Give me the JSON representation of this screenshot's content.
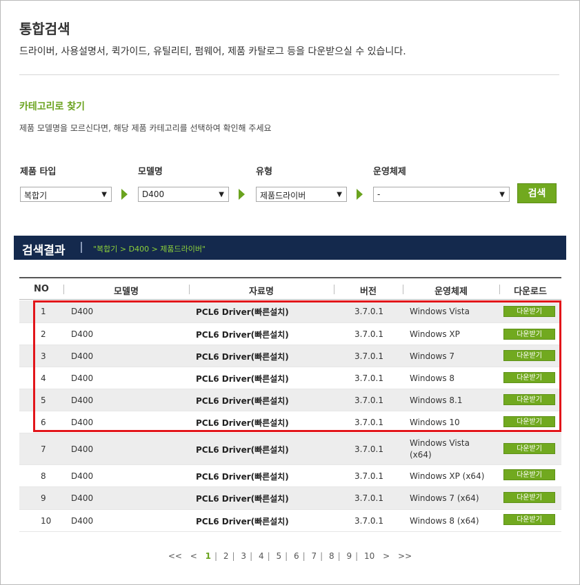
{
  "page": {
    "title": "통합검색",
    "description": "드라이버, 사용설명서, 퀵가이드, 유틸리티, 펌웨어, 제품 카탈로그 등을 다운받으실 수 있습니다."
  },
  "category": {
    "title": "카테고리로 찾기",
    "description": "제품 모델명을 모르신다면, 해당 제품 카테고리를 선택하여 확인해 주세요"
  },
  "filters": {
    "product_type": {
      "label": "제품 타입",
      "value": "복합기"
    },
    "model": {
      "label": "모델명",
      "value": "D400"
    },
    "type": {
      "label": "유형",
      "value": "제품드라이버"
    },
    "os": {
      "label": "운영체제",
      "value": "-"
    },
    "search_label": "검색"
  },
  "results": {
    "title": "검색결과",
    "path": "\"복합기 > D400 > 제품드라이버\""
  },
  "table": {
    "headers": [
      "NO",
      "모델명",
      "자료명",
      "버전",
      "운영체제",
      "다운로드"
    ],
    "rows": [
      {
        "no": "1",
        "model": "D400",
        "doc": "PCL6 Driver(빠른설치)",
        "version": "3.7.0.1",
        "os": "Windows Vista",
        "download": "다운받기"
      },
      {
        "no": "2",
        "model": "D400",
        "doc": "PCL6 Driver(빠른설치)",
        "version": "3.7.0.1",
        "os": "Windows XP",
        "download": "다운받기"
      },
      {
        "no": "3",
        "model": "D400",
        "doc": "PCL6 Driver(빠른설치)",
        "version": "3.7.0.1",
        "os": "Windows 7",
        "download": "다운받기"
      },
      {
        "no": "4",
        "model": "D400",
        "doc": "PCL6 Driver(빠른설치)",
        "version": "3.7.0.1",
        "os": "Windows 8",
        "download": "다운받기"
      },
      {
        "no": "5",
        "model": "D400",
        "doc": "PCL6 Driver(빠른설치)",
        "version": "3.7.0.1",
        "os": "Windows 8.1",
        "download": "다운받기"
      },
      {
        "no": "6",
        "model": "D400",
        "doc": "PCL6 Driver(빠른설치)",
        "version": "3.7.0.1",
        "os": "Windows 10",
        "download": "다운받기"
      },
      {
        "no": "7",
        "model": "D400",
        "doc": "PCL6 Driver(빠른설치)",
        "version": "3.7.0.1",
        "os": "Windows Vista",
        "os2": "(x64)",
        "download": "다운받기"
      },
      {
        "no": "8",
        "model": "D400",
        "doc": "PCL6 Driver(빠른설치)",
        "version": "3.7.0.1",
        "os": "Windows XP (x64)",
        "download": "다운받기"
      },
      {
        "no": "9",
        "model": "D400",
        "doc": "PCL6 Driver(빠른설치)",
        "version": "3.7.0.1",
        "os": "Windows 7 (x64)",
        "download": "다운받기"
      },
      {
        "no": "10",
        "model": "D400",
        "doc": "PCL6 Driver(빠른설치)",
        "version": "3.7.0.1",
        "os": "Windows 8 (x64)",
        "download": "다운받기"
      }
    ]
  },
  "pagination": {
    "first": "<<",
    "prev": "<",
    "pages": [
      "1",
      "2",
      "3",
      "4",
      "5",
      "6",
      "7",
      "8",
      "9",
      "10"
    ],
    "current": "1",
    "next": ">",
    "last": ">>"
  },
  "colors": {
    "accent": "#71a91f",
    "header_bar": "#14294d",
    "highlight": "#e2151a"
  }
}
